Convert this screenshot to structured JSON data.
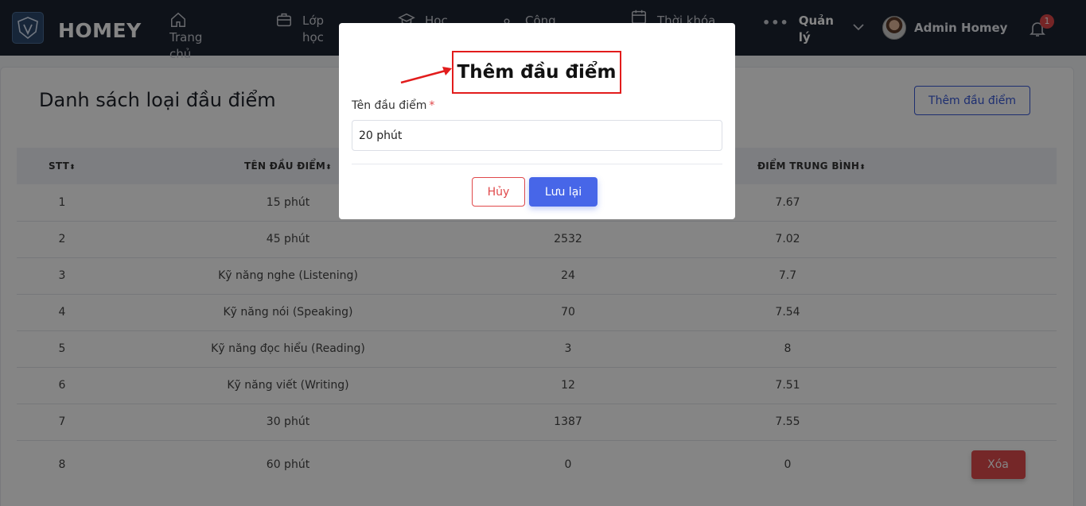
{
  "nav": {
    "brand": "HOMEY",
    "items": [
      {
        "label": "Trang chủ",
        "icon": "home-icon"
      },
      {
        "label": "Lớp học",
        "icon": "briefcase-icon"
      },
      {
        "label": "Học",
        "icon": "graduation-cap-icon"
      },
      {
        "label": "Công",
        "icon": "user-icon"
      },
      {
        "label": "Thời khóa",
        "icon": "calendar-icon"
      }
    ],
    "manage_label": "Quản lý",
    "user_name": "Admin Homey",
    "notification_count": "1"
  },
  "page": {
    "title": "Danh sách loại đầu điểm",
    "add_button": "Thêm đầu điểm"
  },
  "table": {
    "headers": [
      "STT",
      "TÊN ĐẦU ĐIỂM",
      "",
      "ĐIỂM TRUNG BÌNH"
    ],
    "sort_glyph": "⬍",
    "rows": [
      {
        "stt": "1",
        "name": "15 phút",
        "count": "",
        "avg": "7.67"
      },
      {
        "stt": "2",
        "name": "45 phút",
        "count": "2532",
        "avg": "7.02"
      },
      {
        "stt": "3",
        "name": "Kỹ năng nghe (Listening)",
        "count": "24",
        "avg": "7.7"
      },
      {
        "stt": "4",
        "name": "Kỹ năng nói (Speaking)",
        "count": "70",
        "avg": "7.54"
      },
      {
        "stt": "5",
        "name": "Kỹ năng đọc hiểu (Reading)",
        "count": "3",
        "avg": "8"
      },
      {
        "stt": "6",
        "name": "Kỹ năng viết (Writing)",
        "count": "12",
        "avg": "7.51"
      },
      {
        "stt": "7",
        "name": "30 phút",
        "count": "1387",
        "avg": "7.55"
      },
      {
        "stt": "8",
        "name": "60 phút",
        "count": "0",
        "avg": "0"
      }
    ],
    "delete_label": "Xóa"
  },
  "modal": {
    "title": "Thêm đầu điểm",
    "field_label": "Tên đầu điểm",
    "required_mark": "*",
    "field_value": "20 phút",
    "cancel_label": "Hủy",
    "save_label": "Lưu lại"
  },
  "colors": {
    "nav_bg": "#1b2431",
    "primary": "#4766e8",
    "danger": "#e0484a",
    "highlight": "#e21c1c"
  }
}
